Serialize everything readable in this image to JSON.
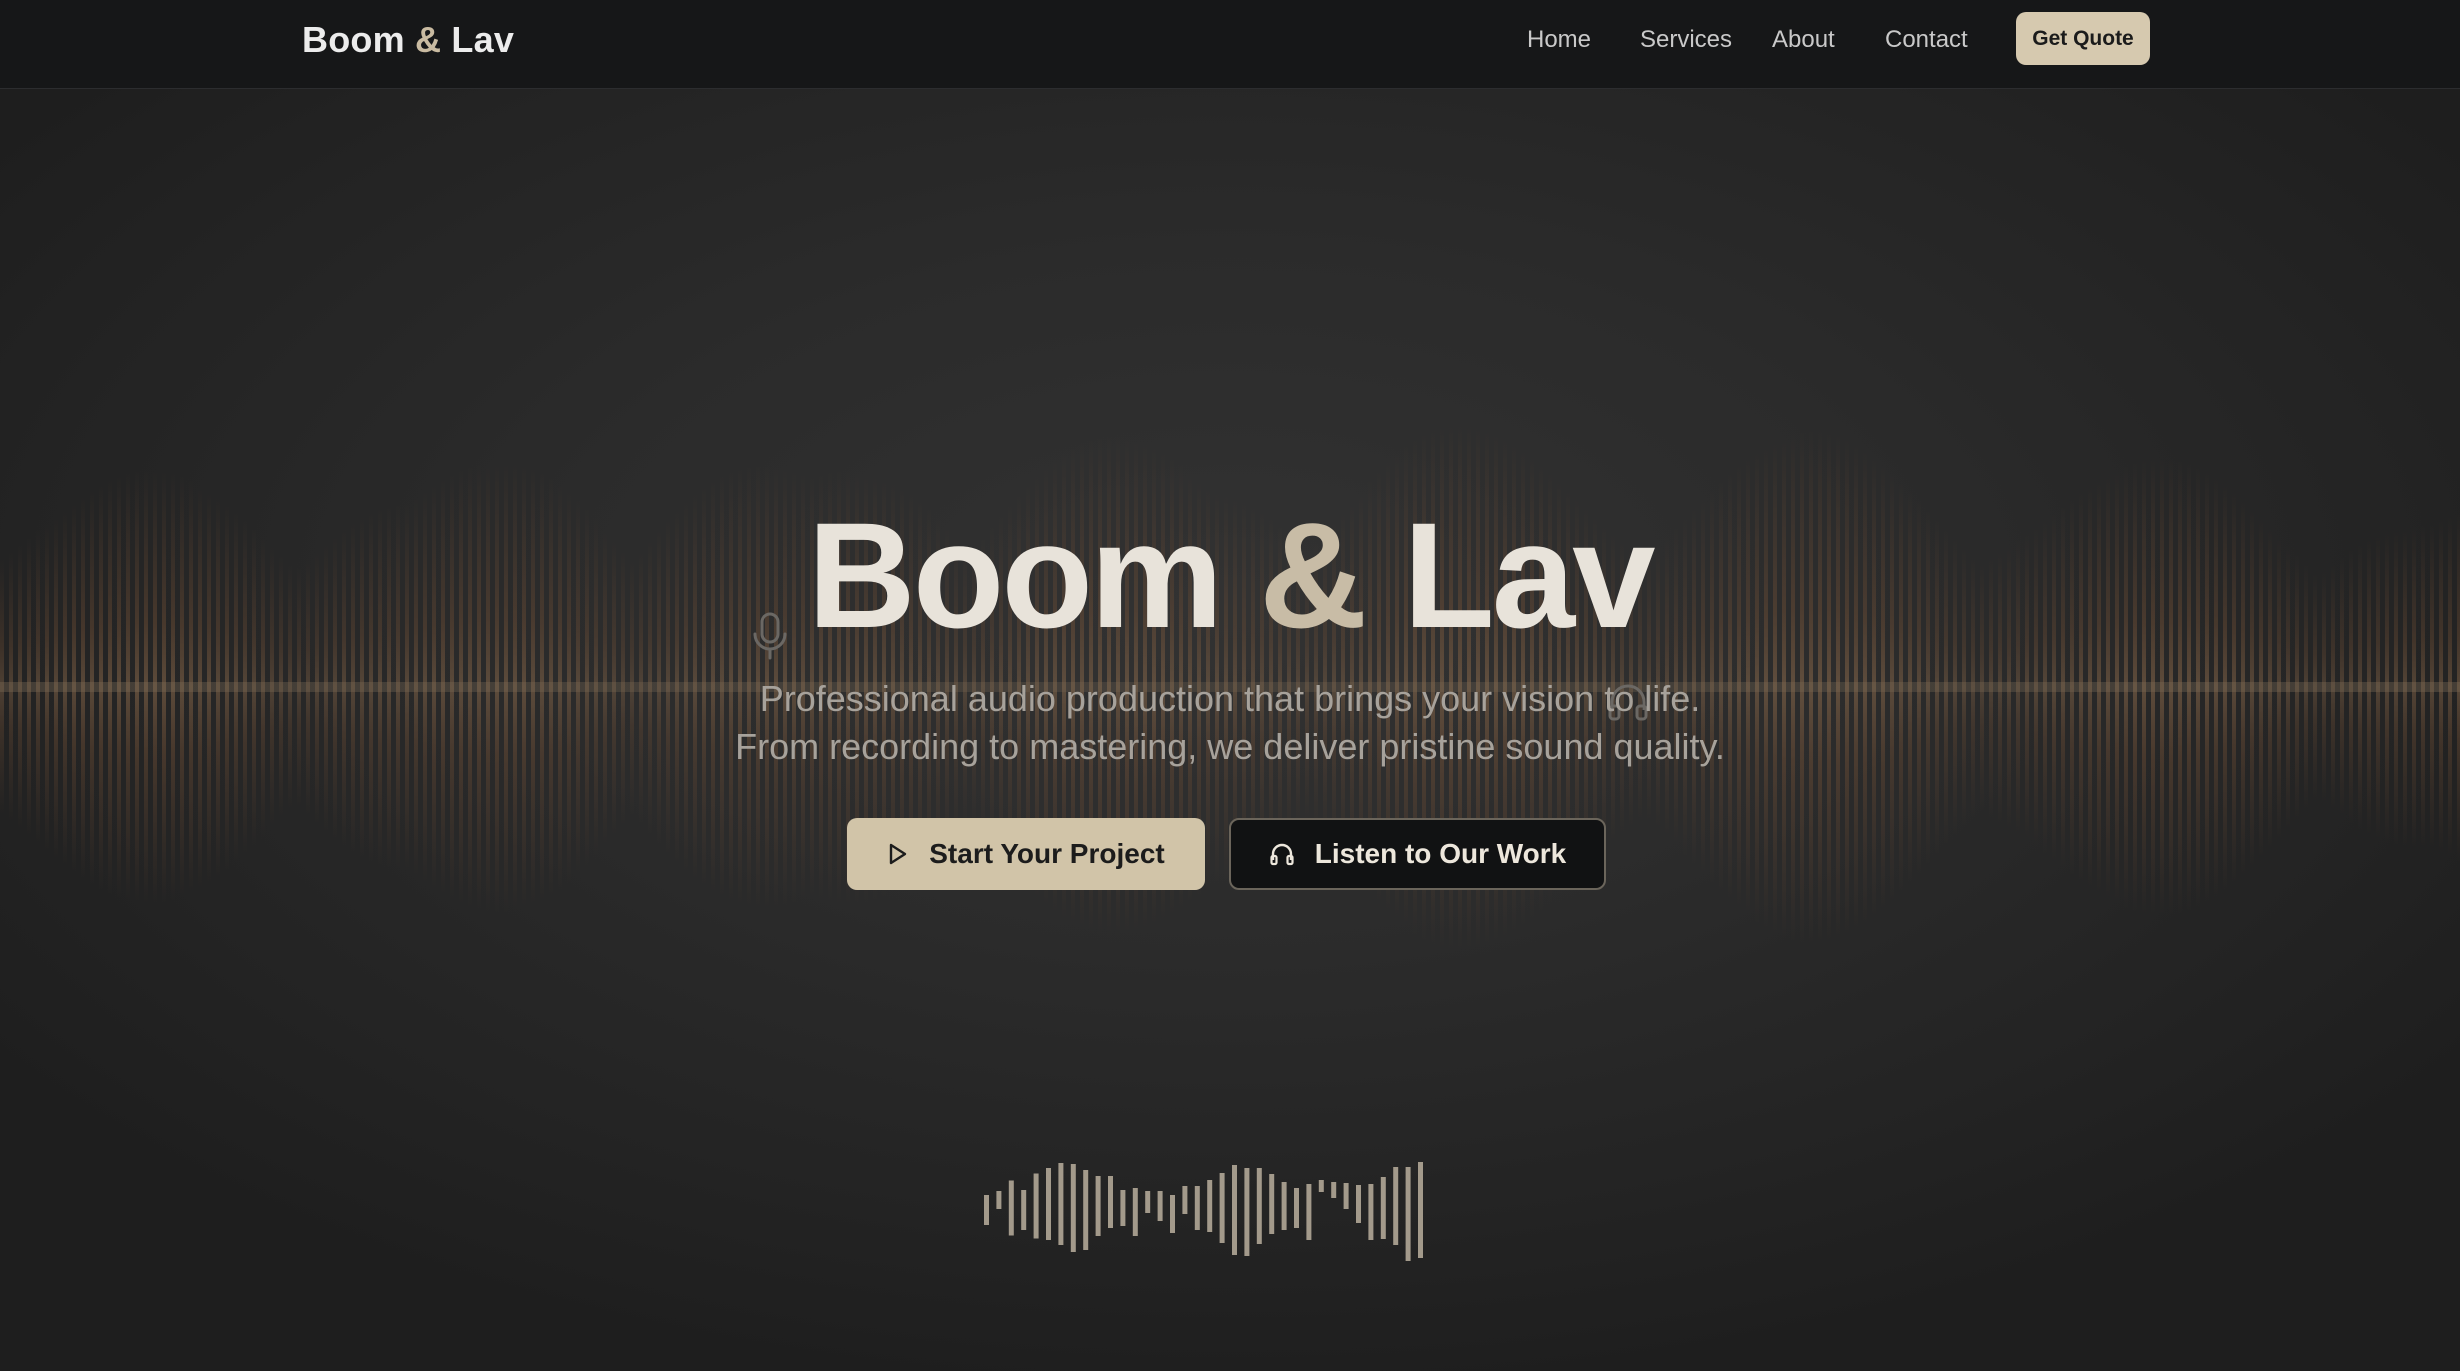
{
  "nav": {
    "brand": {
      "part1": "Boom ",
      "amp": "&",
      "part2": " Lav"
    },
    "links": [
      "Home",
      "Services",
      "About",
      "Contact"
    ],
    "cta": "Get Quote"
  },
  "hero": {
    "title": {
      "part1": "Boom ",
      "amp": "&",
      "part2": " Lav"
    },
    "subtitle_line1": "Professional audio production that brings your vision to life.",
    "subtitle_line2": "From recording to mastering, we deliver pristine sound quality.",
    "primary_button": {
      "label": "Start Your Project",
      "icon": "play-icon"
    },
    "secondary_button": {
      "label": "Listen to Our Work",
      "icon": "headphones-icon"
    },
    "decorative_icons": [
      "microphone-icon",
      "headphones-icon"
    ]
  },
  "colors": {
    "accent": "#d1c4a8",
    "amp_accent": "#c8bca6",
    "nav_background": "#161718",
    "page_background": "#2b2b2b",
    "wave_glow": "#7a5437",
    "equalizer_bar": "#a39a8b"
  }
}
